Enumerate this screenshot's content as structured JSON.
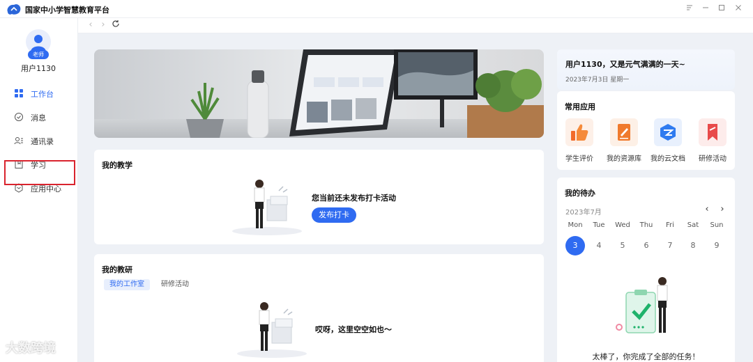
{
  "app": {
    "title": "国家中小学智慧教育平台"
  },
  "user": {
    "role": "老师",
    "name": "用户1130"
  },
  "sidebar": {
    "items": [
      {
        "label": "工作台",
        "icon": "grid-icon",
        "active": true
      },
      {
        "label": "消息",
        "icon": "check-circle-icon"
      },
      {
        "label": "通讯录",
        "icon": "contacts-icon"
      },
      {
        "label": "学习",
        "icon": "book-icon"
      },
      {
        "label": "应用中心",
        "icon": "hexagon-icon"
      }
    ]
  },
  "teaching": {
    "title": "我的教学",
    "empty_text": "您当前还未发布打卡活动",
    "button": "发布打卡"
  },
  "research": {
    "title": "我的教研",
    "tabs": [
      "我的工作室",
      "研修活动"
    ],
    "empty_text": "哎呀，这里空空如也～"
  },
  "greeting": {
    "title": "用户1130，又是元气满满的一天~",
    "date": "2023年7月3日  星期一"
  },
  "common_apps": {
    "title": "常用应用",
    "items": [
      {
        "label": "学生评价",
        "color": "#f26b2a",
        "icon": "thumbs-up-icon"
      },
      {
        "label": "我的资源库",
        "color": "#f07a2d",
        "icon": "edit-doc-icon"
      },
      {
        "label": "我的云文档",
        "color": "#2f7bf0",
        "icon": "cloud-doc-icon"
      },
      {
        "label": "研修活动",
        "color": "#e84a4a",
        "icon": "bookmark-icon"
      }
    ]
  },
  "todo": {
    "title": "我的待办",
    "month": "2023年7月",
    "weekdays": [
      "Mon",
      "Tue",
      "Wed",
      "Thu",
      "Fri",
      "Sat",
      "Sun"
    ],
    "days": [
      "3",
      "4",
      "5",
      "6",
      "7",
      "8",
      "9"
    ],
    "today": "3",
    "done_text": "太棒了，你完成了全部的任务！"
  },
  "watermark": "大数跨境",
  "colors": {
    "accent": "#2f6bf1",
    "highlight": "#d9232d"
  }
}
